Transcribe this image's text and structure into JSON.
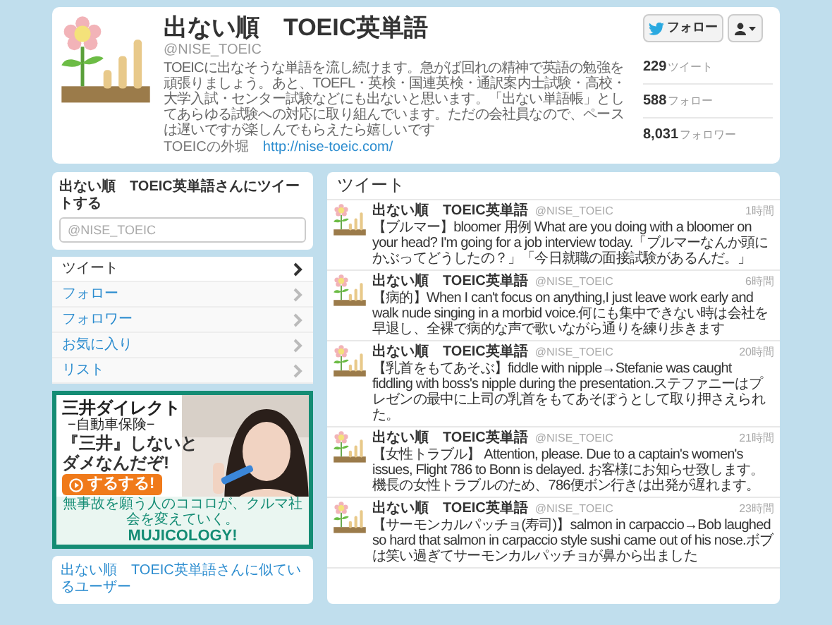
{
  "profile": {
    "name": "出ない順　TOEIC英単語",
    "handle": "@NISE_TOEIC",
    "bio": "TOEICに出なそうな単語を流し続けます。急がば回れの精神で英語の勉強を頑張りましょう。あと、TOEFL・英検・国連英検・通訳案内士試験・高校・大学入試・センター試験などにも出ないと思います。「出ない単語帳」としてあらゆる試験への対応に取り組んでいます。ただの会社員なので、ペースは遅いですが楽しんでもらえたら嬉しいです",
    "location": "TOEICの外堀",
    "url": "http://nise-toeic.com/",
    "follow_button": "フォロー",
    "stats": [
      {
        "count": "229",
        "label": "ツイート"
      },
      {
        "count": "588",
        "label": "フォロー"
      },
      {
        "count": "8,031",
        "label": "フォロワー"
      }
    ]
  },
  "tweet_box": {
    "title": "出ない順　TOEIC英単語さんにツイートする",
    "placeholder": "@NISE_TOEIC"
  },
  "nav": [
    {
      "label": "ツイート",
      "selected": true
    },
    {
      "label": "フォロー",
      "selected": false
    },
    {
      "label": "フォロワー",
      "selected": false
    },
    {
      "label": "お気に入り",
      "selected": false
    },
    {
      "label": "リスト",
      "selected": false
    }
  ],
  "ad": {
    "brand": "三井ダイレクト",
    "subtitle": "−自動車保険−",
    "headline_1": "『三井』しないと",
    "headline_2": "ダメなんだぞ!",
    "button": "するする!",
    "tagline": "無事故を願う人のココロが、クルマ社会を変えていく。",
    "logo": "MUJICOLOGY!"
  },
  "similar": {
    "title": "出ない順　TOEIC英単語さんに似ているユーザー"
  },
  "tweets_header": "ツイート",
  "tweets": [
    {
      "name": "出ない順　TOEIC英単語",
      "handle": "@NISE_TOEIC",
      "time": "1時間",
      "text": "【ブルマー】bloomer 用例 What are you doing with a bloomer on your head? I'm going for a job interview today.「ブルマーなんか頭にかぶってどうしたの？」「今日就職の面接試験があるんだ。」"
    },
    {
      "name": "出ない順　TOEIC英単語",
      "handle": "@NISE_TOEIC",
      "time": "6時間",
      "text": "【病的】When I can't focus on anything,I just leave work early and walk nude singing in a morbid voice.何にも集中できない時は会社を早退し、全裸で病的な声で歌いながら通りを練り歩きます"
    },
    {
      "name": "出ない順　TOEIC英単語",
      "handle": "@NISE_TOEIC",
      "time": "20時間",
      "text": "【乳首をもてあそぶ】fiddle with nipple→Stefanie was caught fiddling with boss's nipple during the presentation.ステファニーはプレゼンの最中に上司の乳首をもてあそぼうとして取り押さえられた。"
    },
    {
      "name": "出ない順　TOEIC英単語",
      "handle": "@NISE_TOEIC",
      "time": "21時間",
      "text": "【女性トラブル】 Attention, please. Due to a captain's women's issues, Flight 786 to Bonn is delayed.  お客様にお知らせ致します。機長の女性トラブルのため、786便ボン行きは出発が遅れます。"
    },
    {
      "name": "出ない順　TOEIC英単語",
      "handle": "@NISE_TOEIC",
      "time": "23時間",
      "text": "【サーモンカルパッチョ(寿司)】salmon in carpaccio→Bob laughed so hard that salmon in carpaccio style sushi came out of his nose.ボブは笑い過ぎてサーモンカルパッチョが鼻から出ました"
    }
  ]
}
